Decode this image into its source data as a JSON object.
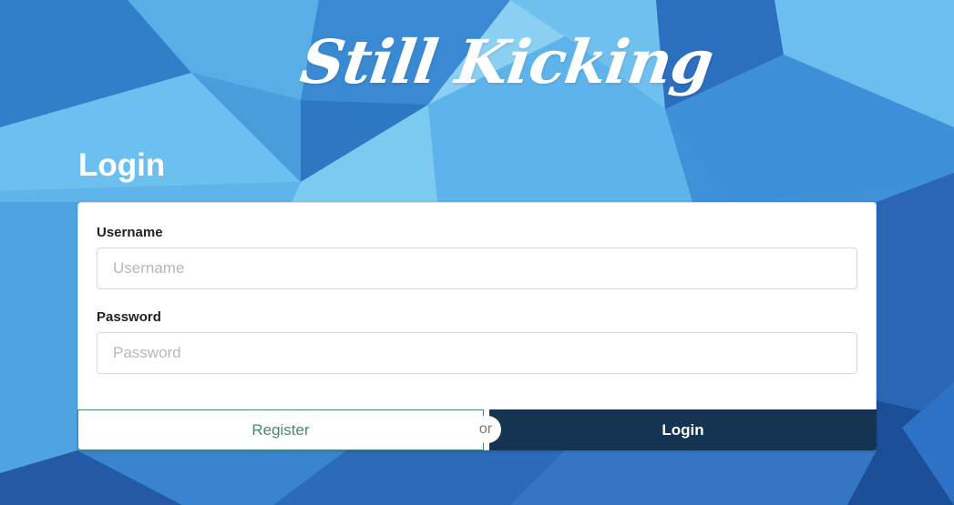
{
  "brand": {
    "logo_text": "Still Kicking"
  },
  "page": {
    "title": "Login"
  },
  "form": {
    "username": {
      "label": "Username",
      "placeholder": "Username",
      "value": ""
    },
    "password": {
      "label": "Password",
      "placeholder": "Password",
      "value": ""
    }
  },
  "actions": {
    "register_label": "Register",
    "separator": "or",
    "login_label": "Login"
  },
  "colors": {
    "background": "#3f92d8",
    "login_button": "#143451",
    "register_accent": "#4a8a6a"
  }
}
